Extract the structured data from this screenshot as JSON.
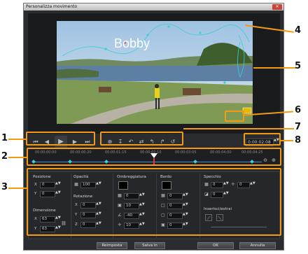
{
  "window": {
    "title": "Personalizza movimento",
    "close_label": "✕"
  },
  "video": {
    "overlay_text": "Bobby"
  },
  "playback": {
    "buttons": [
      "home-icon",
      "prev-frame-icon",
      "play-icon",
      "next-frame-icon",
      "end-icon"
    ],
    "timecode": "0:00:02:08"
  },
  "path_tools": [
    "add-keyframe-icon",
    "remove-keyframe-icon",
    "reverse-icon",
    "swap-icon",
    "move-left-icon",
    "move-right-icon",
    "reset-icon"
  ],
  "timeline": {
    "labels": [
      "00:00:00:00",
      "00:00:00:20",
      "00:00:01:15",
      "00:00:02:10",
      "00:00:03:05",
      "00:00:04:00",
      "00:00:04:25"
    ]
  },
  "properties": {
    "posizione": {
      "title": "Posizione",
      "x_label": "X",
      "x": "0",
      "y_label": "Y",
      "y": "0"
    },
    "dimensione": {
      "title": "Dimensione",
      "x_label": "X",
      "x": "63",
      "y_label": "Y",
      "y": "63"
    },
    "opacita": {
      "title": "Opacità",
      "value": "100"
    },
    "rotazione": {
      "title": "Rotazione",
      "x_label": "X",
      "x": "0",
      "y_label": "Y",
      "y": "0",
      "z_label": "Z",
      "z": "0"
    },
    "ombreggiatura": {
      "title": "Ombreggiatura",
      "v1": "0",
      "v2": "10",
      "v3": "-40",
      "v4": "10"
    },
    "bordo": {
      "title": "Bordo",
      "v1": "0",
      "v2": "0",
      "v3": "0",
      "v4": "0"
    },
    "specchio": {
      "title": "Specchio",
      "v1": "0",
      "v2": "0",
      "v3": "0"
    },
    "inserisci": {
      "title": "Inserisci/estrai"
    }
  },
  "footer": {
    "reimposta": "Reimposta",
    "salva": "Salva in",
    "ok": "OK",
    "annulla": "Annulla"
  },
  "callouts": [
    "1",
    "2",
    "3",
    "4",
    "5",
    "6",
    "7",
    "8"
  ],
  "colors": {
    "accent": "#f39a12",
    "path": "#3ad0d0"
  }
}
